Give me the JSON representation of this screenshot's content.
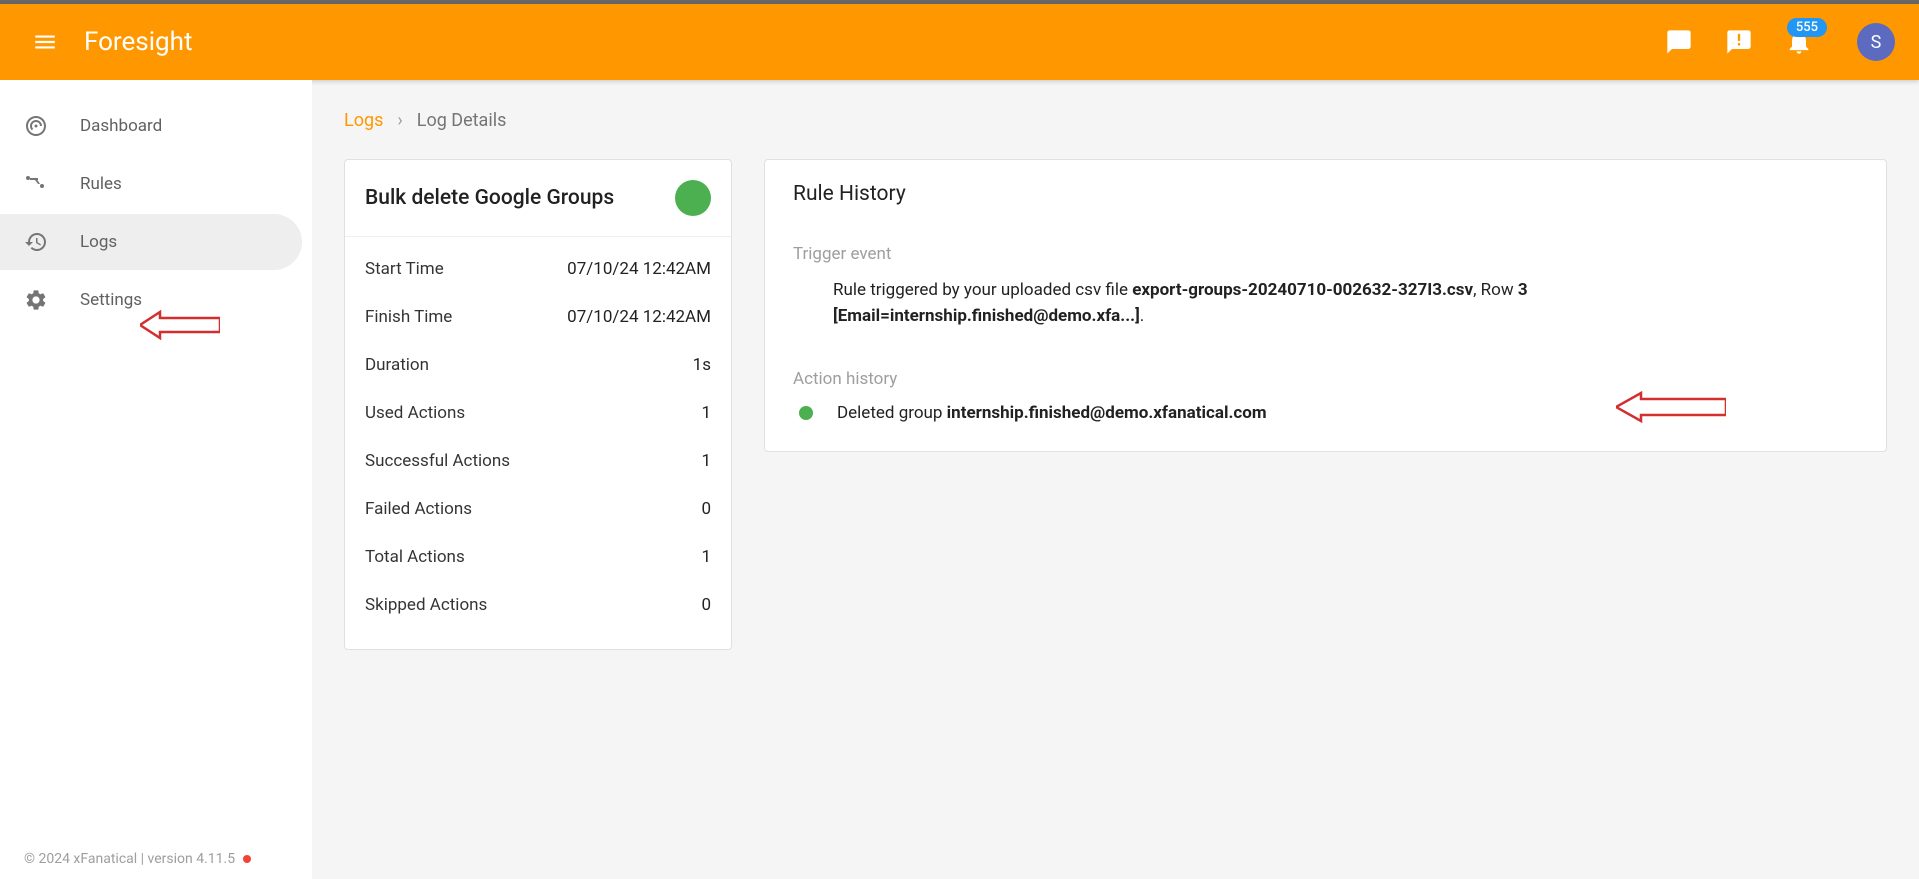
{
  "header": {
    "title": "Foresight",
    "notif_count": "555",
    "avatar_letter": "S"
  },
  "sidebar": {
    "items": [
      {
        "label": "Dashboard"
      },
      {
        "label": "Rules"
      },
      {
        "label": "Logs"
      },
      {
        "label": "Settings"
      }
    ]
  },
  "breadcrumb": {
    "root": "Logs",
    "current": "Log Details"
  },
  "summary": {
    "title": "Bulk delete Google Groups",
    "rows": [
      {
        "label": "Start Time",
        "value": "07/10/24 12:42AM"
      },
      {
        "label": "Finish Time",
        "value": "07/10/24 12:42AM"
      },
      {
        "label": "Duration",
        "value": "1s"
      },
      {
        "label": "Used Actions",
        "value": "1"
      },
      {
        "label": "Successful Actions",
        "value": "1"
      },
      {
        "label": "Failed Actions",
        "value": "0"
      },
      {
        "label": "Total Actions",
        "value": "1"
      },
      {
        "label": "Skipped Actions",
        "value": "0"
      }
    ]
  },
  "history": {
    "title": "Rule History",
    "trigger_label": "Trigger event",
    "trigger": {
      "prefix": "Rule triggered by your uploaded csv file ",
      "file": "export-groups-20240710-002632-327I3.csv",
      "mid": ", Row ",
      "row": "3",
      "line2_prefix": " [Email=internship.finished@demo.xfa...]",
      "suffix": "."
    },
    "action_label": "Action history",
    "action": {
      "prefix": "Deleted group ",
      "email": "internship.finished@demo.xfanatical.com"
    }
  },
  "footer": {
    "text": "© 2024 xFanatical | version 4.11.5"
  }
}
